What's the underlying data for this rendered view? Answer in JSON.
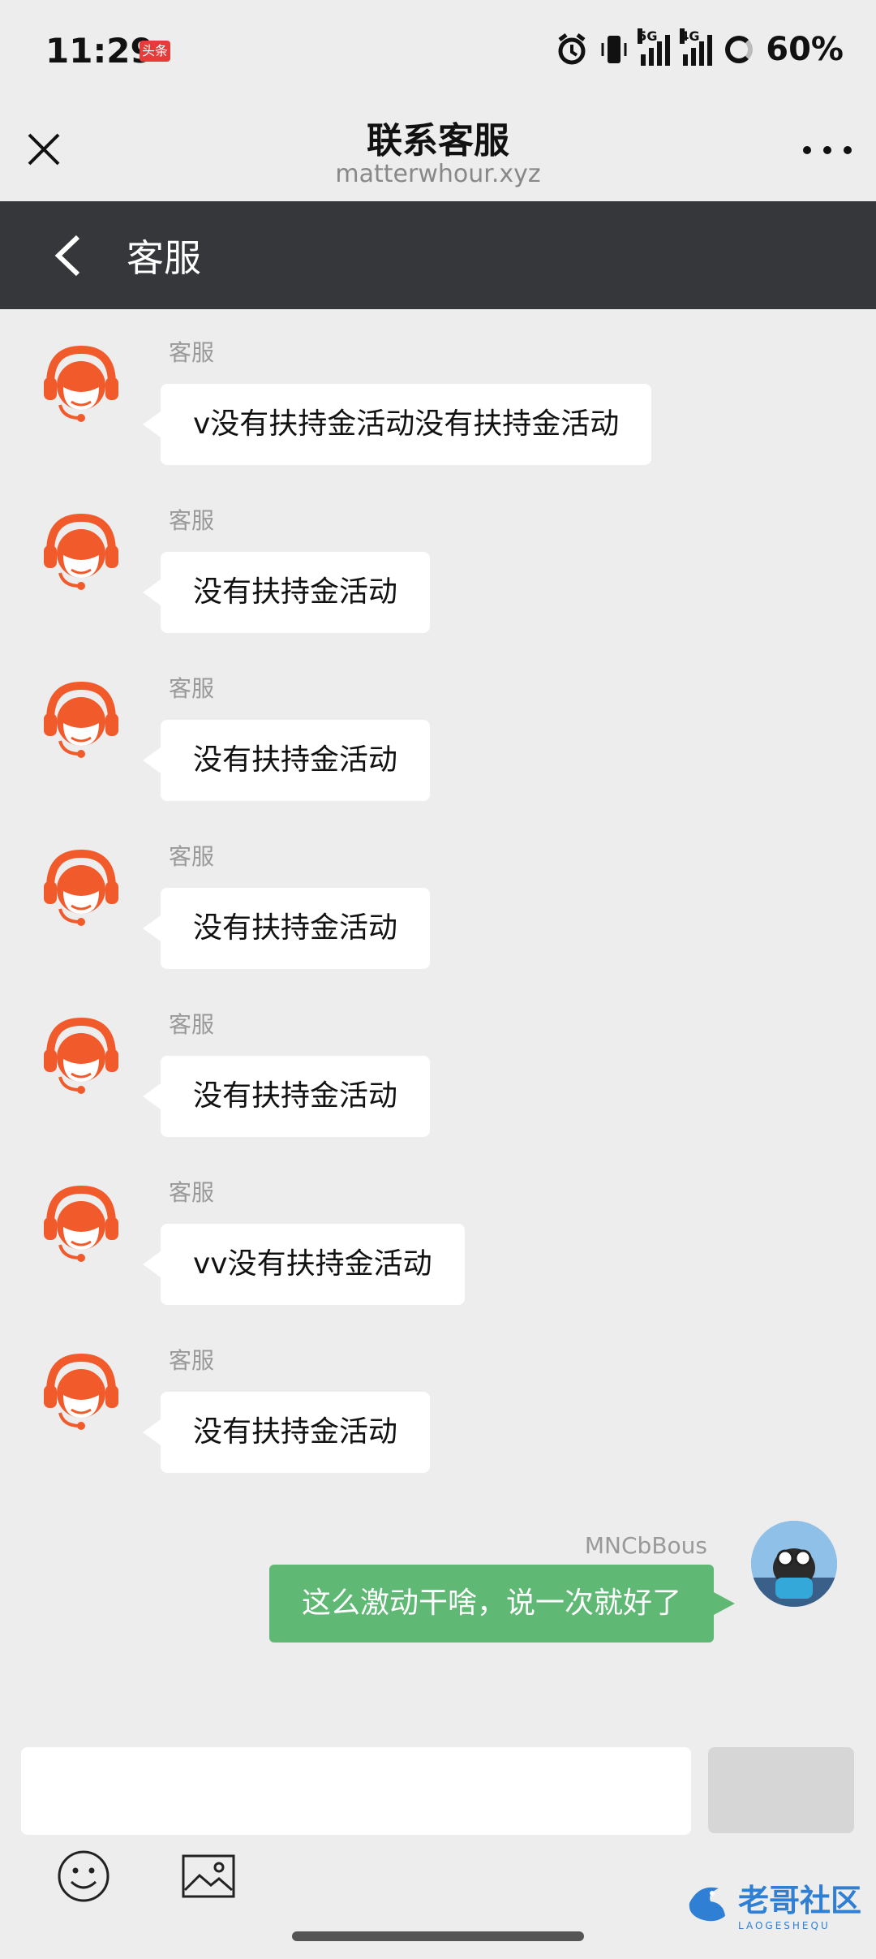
{
  "status_bar": {
    "time": "11:29",
    "app_badge": "头条",
    "net1": "5G",
    "net2": "4G",
    "battery": "60%"
  },
  "title_bar": {
    "title": "联系客服",
    "subtitle": "matterwhour.xyz"
  },
  "chat_header": {
    "title": "客服"
  },
  "messages": [
    {
      "sender": "",
      "text": "没有扶持金活动"
    },
    {
      "sender": "客服",
      "text": "v没有扶持金活动没有扶持金活动"
    },
    {
      "sender": "客服",
      "text": "没有扶持金活动"
    },
    {
      "sender": "客服",
      "text": "没有扶持金活动"
    },
    {
      "sender": "客服",
      "text": "没有扶持金活动"
    },
    {
      "sender": "客服",
      "text": "没有扶持金活动"
    },
    {
      "sender": "客服",
      "text": "vv没有扶持金活动"
    },
    {
      "sender": "客服",
      "text": "没有扶持金活动"
    }
  ],
  "my_message": {
    "sender": "MNCbBous",
    "text": "这么激动干啥，说一次就好了"
  },
  "input": {
    "placeholder": ""
  },
  "watermark": {
    "text": "老哥社区",
    "sub": "LAOGESHEQU"
  },
  "colors": {
    "accent_orange": "#f15a2b",
    "my_bubble": "#5fb874",
    "dark_header": "#35373a"
  }
}
